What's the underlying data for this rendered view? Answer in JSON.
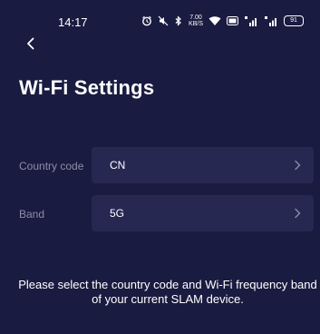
{
  "status_bar": {
    "time": "14:17",
    "speed_value": "7.00",
    "speed_unit": "KB/S",
    "battery": "91"
  },
  "header": {
    "back_icon": "chevron-left-icon",
    "title": "Wi-Fi Settings"
  },
  "settings": {
    "country": {
      "label": "Country code",
      "value": "CN"
    },
    "band": {
      "label": "Band",
      "value": "5G"
    }
  },
  "hint": "Please select the country code and Wi-Fi frequency band of your current SLAM device.",
  "colors": {
    "background": "#1a1b40",
    "row_background": "#262852",
    "label_color": "#8b8ea6",
    "text_color": "#ffffff"
  }
}
